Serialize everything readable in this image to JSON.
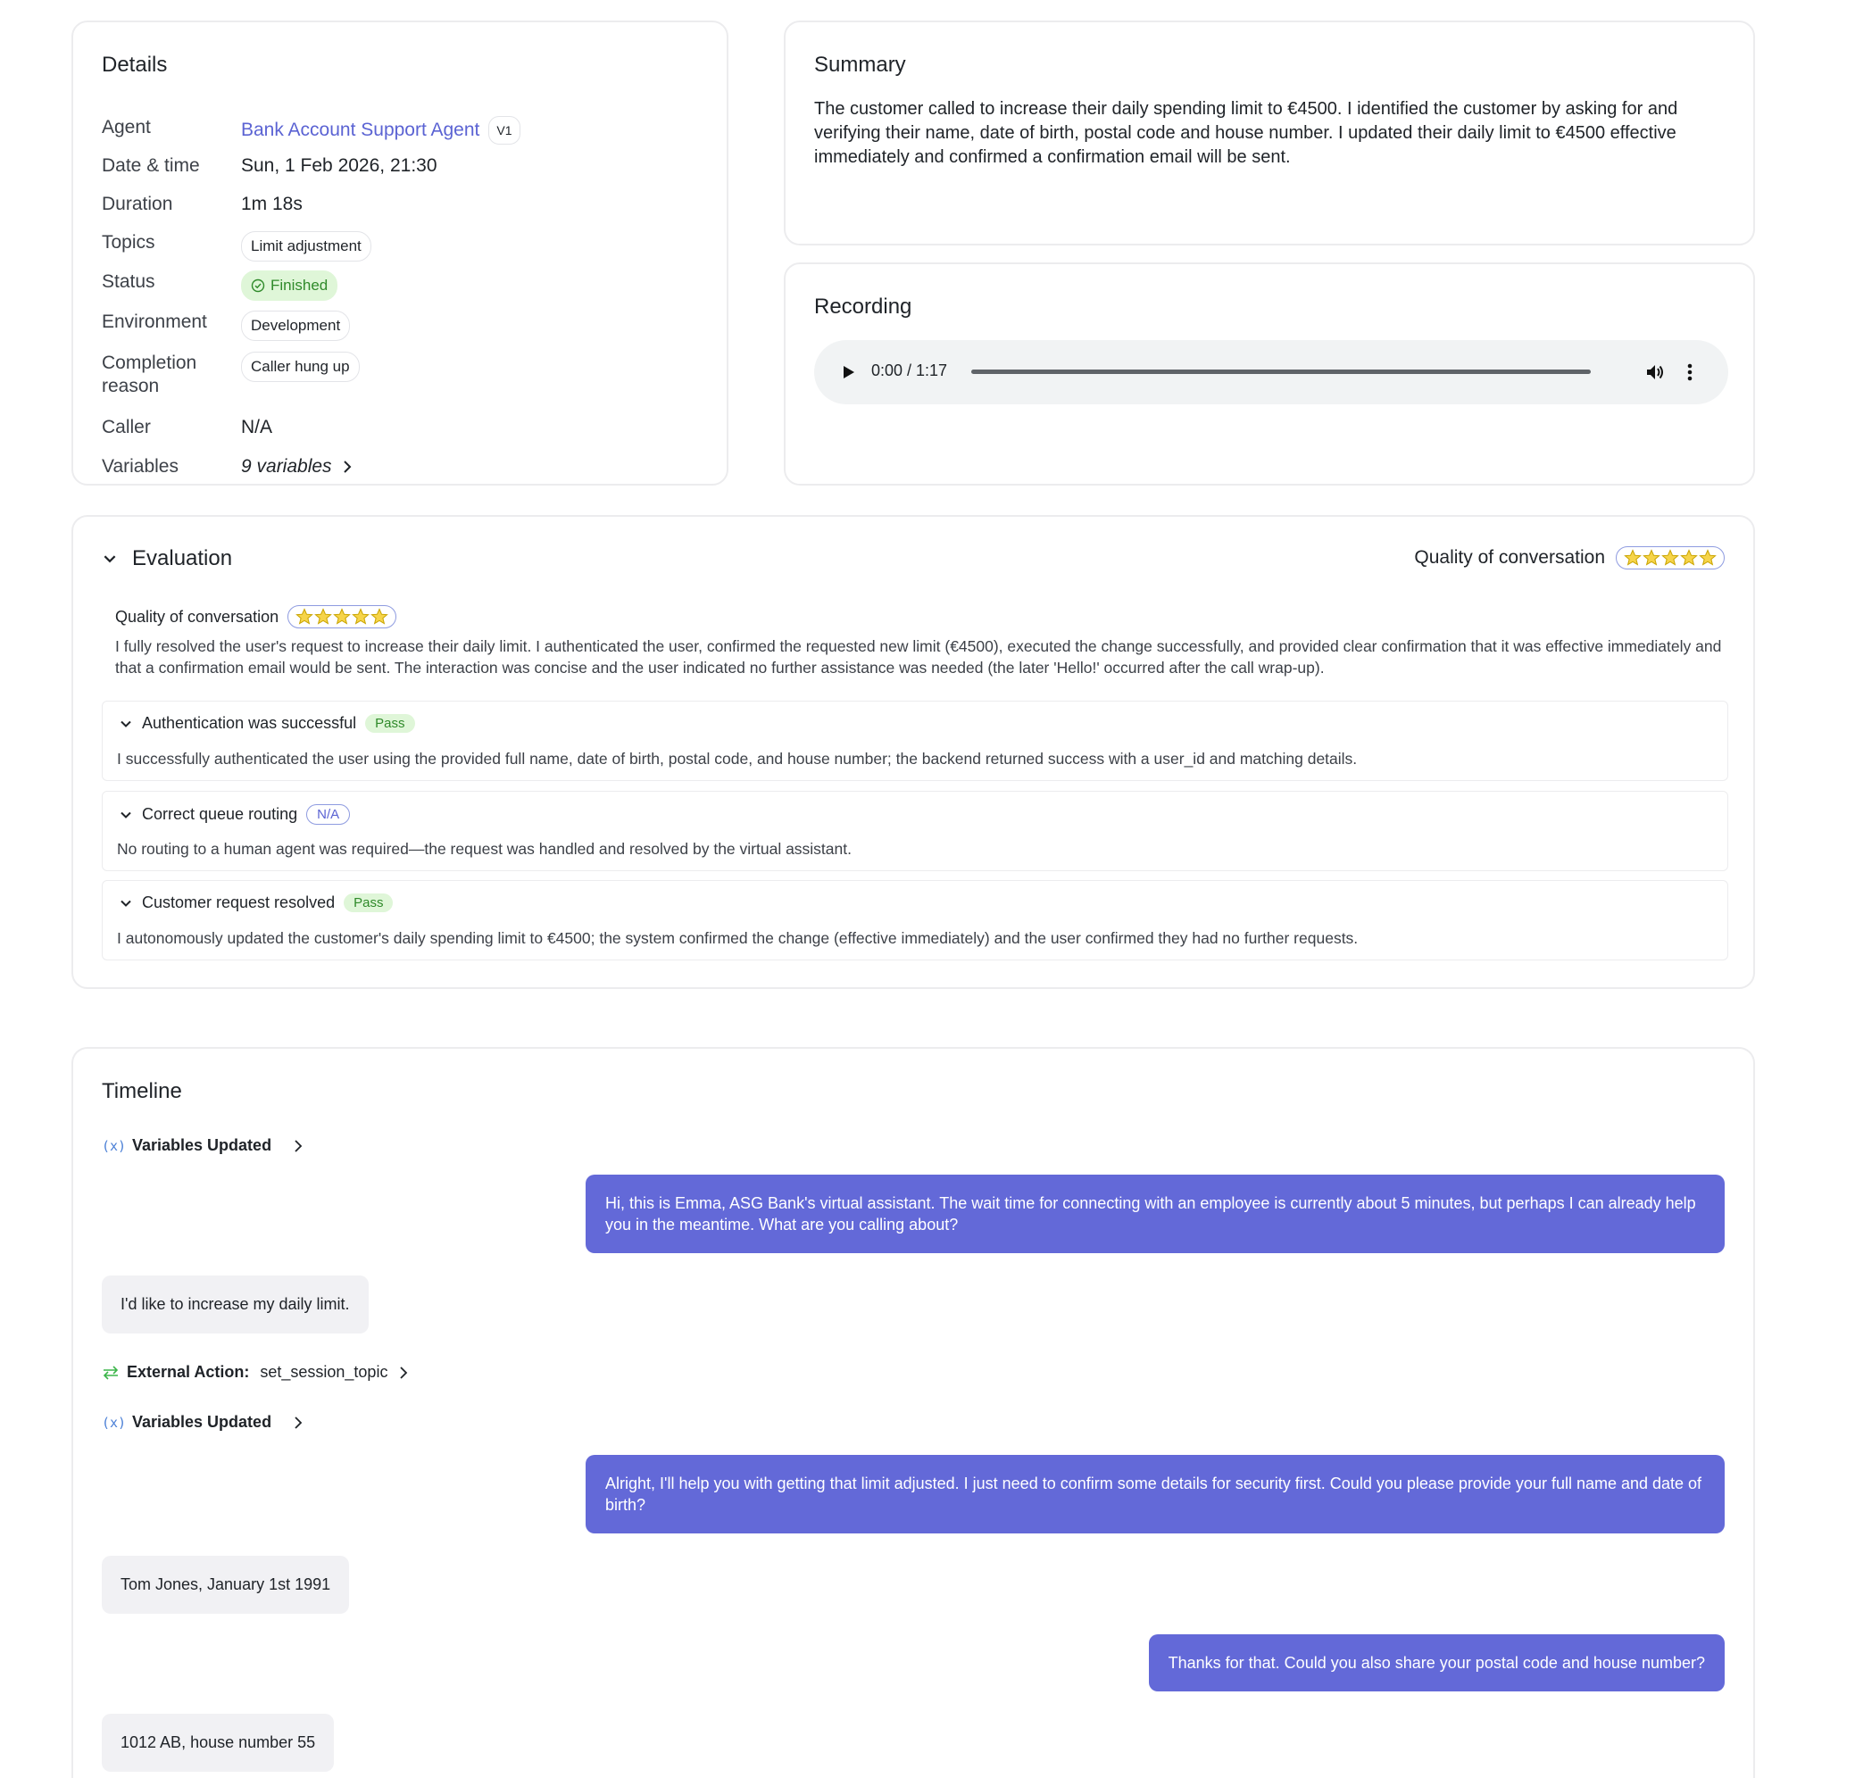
{
  "details": {
    "title": "Details",
    "agent_label": "Agent",
    "agent_value": "Bank Account Support Agent",
    "agent_version": "V1",
    "datetime_label": "Date & time",
    "datetime_value": "Sun, 1 Feb 2026, 21:30",
    "duration_label": "Duration",
    "duration_value": "1m 18s",
    "topics_label": "Topics",
    "topics_value": "Limit adjustment",
    "status_label": "Status",
    "status_value": "Finished",
    "environment_label": "Environment",
    "environment_value": "Development",
    "completion_label_1": "Completion",
    "completion_label_2": "reason",
    "completion_value": "Caller hung up",
    "caller_label": "Caller",
    "caller_value": "N/A",
    "variables_label": "Variables",
    "variables_value": "9 variables"
  },
  "summary": {
    "title": "Summary",
    "text": "The customer called to increase their daily spending limit to €4500. I identified the customer by asking for and verifying their name, date of birth, postal code and house number. I updated their daily limit to €4500 effective immediately and confirmed a confirmation email will be sent."
  },
  "recording": {
    "title": "Recording",
    "time": "0:00 / 1:17",
    "progress": 0
  },
  "evaluation": {
    "title": "Evaluation",
    "quality_label": "Quality of conversation",
    "quality_rating": 5,
    "quality_max": 5,
    "overall_text": "I fully resolved the user's request to increase their daily limit. I authenticated the user, confirmed the requested new limit (€4500), executed the change successfully, and provided clear confirmation that it was effective immediately and that a confirmation email would be sent. The interaction was concise and the user indicated no further assistance was needed (the later 'Hello!' occurred after the call wrap-up).",
    "criteria": [
      {
        "name": "Authentication was successful",
        "result": "Pass",
        "text": "I successfully authenticated the user using the provided full name, date of birth, postal code, and house number; the backend returned success with a user_id and matching details."
      },
      {
        "name": "Correct queue routing",
        "result": "N/A",
        "text": "No routing to a human agent was required—the request was handled and resolved by the virtual assistant."
      },
      {
        "name": "Customer request resolved",
        "result": "Pass",
        "text": "I autonomously updated the customer's daily spending limit to €4500; the system confirmed the change (effective immediately) and the user confirmed they had no further requests."
      }
    ]
  },
  "timeline": {
    "title": "Timeline",
    "var_icon": "(x)",
    "variables_updated": "Variables Updated",
    "external_action_label": "External Action:",
    "external_action_value": "set_session_topic",
    "messages": [
      {
        "role": "bot",
        "text": "Hi, this is Emma, ASG Bank's virtual assistant. The wait time for connecting with an employee is currently about 5 minutes, but perhaps I can already help you in the meantime. What are you calling about?"
      },
      {
        "role": "user",
        "text": "I'd like to increase my daily limit."
      },
      {
        "role": "bot",
        "text": "Alright, I'll help you with getting that limit adjusted. I just need to confirm some details for security first. Could you please provide your full name and date of birth?"
      },
      {
        "role": "user",
        "text": "Tom Jones, January 1st 1991"
      },
      {
        "role": "bot",
        "text": "Thanks for that. Could you also share your postal code and house number?"
      },
      {
        "role": "user",
        "text": "1012 AB, house number 55"
      }
    ]
  },
  "colors": {
    "accent": "#6369d8",
    "link": "#5b63d3",
    "pass_bg": "#dff6d8",
    "pass_text": "#2f8a2a"
  }
}
